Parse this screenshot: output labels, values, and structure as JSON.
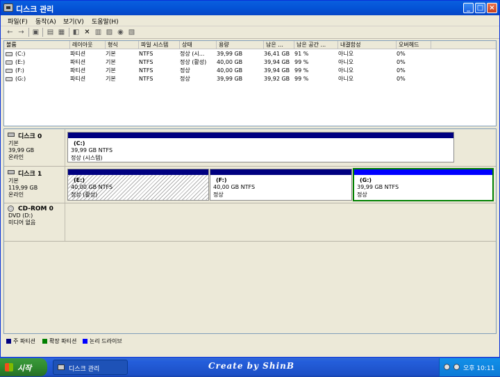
{
  "window": {
    "title": "디스크 관리",
    "controls": {
      "minimize": "_",
      "maximize": "□",
      "close": "×"
    }
  },
  "menu": [
    "파일(F)",
    "동작(A)",
    "보기(V)",
    "도움말(H)"
  ],
  "toolbar_icons": [
    "back-arrow-icon",
    "forward-arrow-icon",
    "console-icon",
    "properties-icon",
    "help-icon",
    "refresh-icon",
    "delete-icon",
    "list-icon",
    "open-icon",
    "search-icon",
    "properties-page-icon"
  ],
  "volume_list": {
    "columns": [
      "볼륨",
      "레이아웃",
      "형식",
      "파일 시스템",
      "상태",
      "용량",
      "남은 ...",
      "남은 공간 ...",
      "내결함성",
      "오버헤드"
    ],
    "rows": [
      [
        "(C:)",
        "파티션",
        "기본",
        "NTFS",
        "정상 (시...",
        "39,99 GB",
        "36,41 GB",
        "91 %",
        "아니오",
        "0%"
      ],
      [
        "(E:)",
        "파티션",
        "기본",
        "NTFS",
        "정상 (활성)",
        "40,00 GB",
        "39,94 GB",
        "99 %",
        "아니오",
        "0%"
      ],
      [
        "(F:)",
        "파티션",
        "기본",
        "NTFS",
        "정상",
        "40,00 GB",
        "39,94 GB",
        "99 %",
        "아니오",
        "0%"
      ],
      [
        "(G:)",
        "파티션",
        "기본",
        "NTFS",
        "정상",
        "39,99 GB",
        "39,92 GB",
        "99 %",
        "아니오",
        "0%"
      ]
    ]
  },
  "disks": [
    {
      "name": "디스크 0",
      "type": "기본",
      "size": "39,99 GB",
      "status": "온라인",
      "partitions": [
        {
          "name": "(C:)",
          "size": "39,99 GB NTFS",
          "state": "정상 (시스템)"
        }
      ]
    },
    {
      "name": "디스크 1",
      "type": "기본",
      "size": "119,99 GB",
      "status": "온라인",
      "partitions": [
        {
          "name": "(E:)",
          "size": "40,00 GB NTFS",
          "state": "정상 (활성)"
        },
        {
          "name": "(F:)",
          "size": "40,00 GB NTFS",
          "state": "정상"
        },
        {
          "name": "(G:)",
          "size": "39,99 GB NTFS",
          "state": "정상"
        }
      ]
    },
    {
      "name": "CD-ROM 0",
      "type": "DVD (D:)",
      "size": "",
      "status": "미디어 없음",
      "partitions": []
    }
  ],
  "legend": [
    {
      "label": "주 파티션",
      "color": "#000080"
    },
    {
      "label": "확장 파티션",
      "color": "#008000"
    },
    {
      "label": "논리 드라이브",
      "color": "#0000ff"
    }
  ],
  "taskbar": {
    "start_label": "시작",
    "task_label": "디스크 관리",
    "watermark": "Create by ShinB",
    "clock": "오후 10:11"
  }
}
